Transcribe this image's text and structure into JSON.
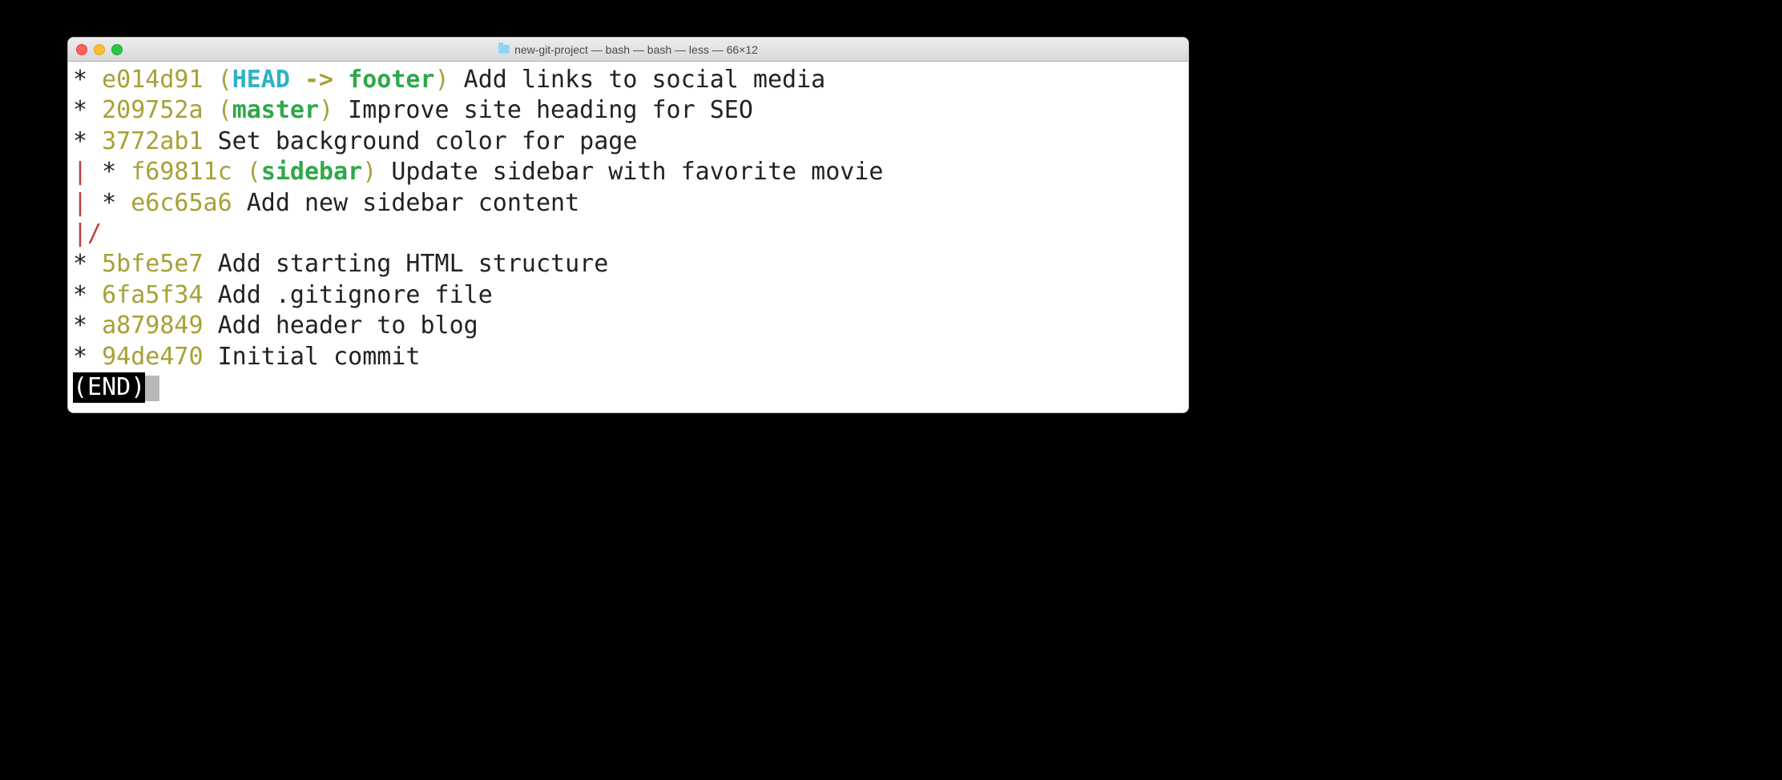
{
  "window": {
    "title": "new-git-project — bash — bash — less — 66×12"
  },
  "log": {
    "lines": [
      {
        "graph": "* ",
        "hash": "e014d91",
        "refs": {
          "open": " (",
          "head": "HEAD",
          "arrow": " -> ",
          "branch": "footer",
          "close": ")"
        },
        "message": " Add links to social media"
      },
      {
        "graph": "* ",
        "hash": "209752a",
        "refs": {
          "open": " (",
          "branch": "master",
          "close": ")"
        },
        "message": " Improve site heading for SEO"
      },
      {
        "graph": "* ",
        "hash": "3772ab1",
        "message": " Set background color for page"
      },
      {
        "graph_red": "|",
        "graph": " * ",
        "hash": "f69811c",
        "refs": {
          "open": " (",
          "branch": "sidebar",
          "close": ")"
        },
        "message": " Update sidebar with favorite movie"
      },
      {
        "graph_red": "|",
        "graph": " * ",
        "hash": "e6c65a6",
        "message": " Add new sidebar content"
      },
      {
        "graph_red": "|/",
        "graph_only": true
      },
      {
        "graph": "* ",
        "hash": "5bfe5e7",
        "message": " Add starting HTML structure"
      },
      {
        "graph": "* ",
        "hash": "6fa5f34",
        "message": " Add .gitignore file"
      },
      {
        "graph": "* ",
        "hash": "a879849",
        "message": " Add header to blog"
      },
      {
        "graph": "* ",
        "hash": "94de470",
        "message": " Initial commit"
      }
    ]
  },
  "pager": {
    "end": "(END)"
  }
}
